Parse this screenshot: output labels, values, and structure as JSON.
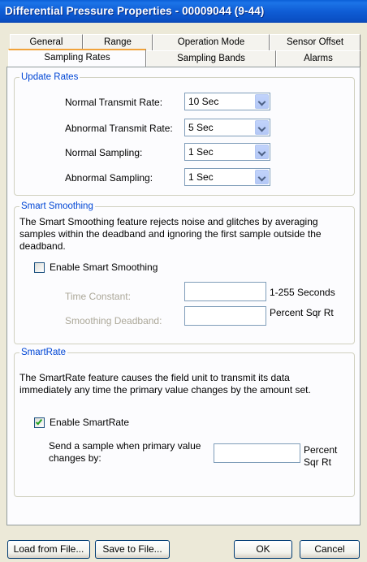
{
  "window": {
    "title": "Differential Pressure Properties - 00009044 (9-44)"
  },
  "tabs": {
    "row1": [
      "General",
      "Range",
      "Operation Mode",
      "Sensor Offset"
    ],
    "row2": [
      "Sampling Rates",
      "Sampling Bands",
      "Alarms"
    ],
    "active": "Sampling Rates"
  },
  "update_rates": {
    "title": "Update Rates",
    "rows": [
      {
        "label": "Normal Transmit Rate:",
        "value": "10 Sec"
      },
      {
        "label": "Abnormal Transmit Rate:",
        "value": "5 Sec"
      },
      {
        "label": "Normal Sampling:",
        "value": "1 Sec"
      },
      {
        "label": "Abnormal Sampling:",
        "value": "1 Sec"
      }
    ]
  },
  "smart_smoothing": {
    "title": "Smart Smoothing",
    "description": "The Smart Smoothing feature rejects noise and glitches by averaging samples within the deadband and ignoring the first sample outside the deadband.",
    "line1": "The Smart Smoothing feature rejects noise and glitches by averaging",
    "line2": "samples within the deadband and ignoring the first sample outside the",
    "line3": "deadband.",
    "enable_label": "Enable Smart Smoothing",
    "enabled": false,
    "time_constant_label": "Time Constant:",
    "time_constant_value": "",
    "time_constant_unit": "1-255 Seconds",
    "deadband_label": "Smoothing Deadband:",
    "deadband_value": "",
    "deadband_unit": "Percent Sqr Rt"
  },
  "smartrate": {
    "title": "SmartRate",
    "line1": "The SmartRate feature causes the field unit to transmit its data",
    "line2": "immediately any time the primary value changes by the amount set.",
    "enable_label": "Enable SmartRate",
    "enabled": true,
    "send_label_line1": "Send a sample when primary value",
    "send_label_line2": "changes by:",
    "send_value": "",
    "unit_line1": "Percent",
    "unit_line2": "Sqr Rt"
  },
  "buttons": {
    "load": "Load from File...",
    "save": "Save to File...",
    "ok": "OK",
    "cancel": "Cancel"
  }
}
